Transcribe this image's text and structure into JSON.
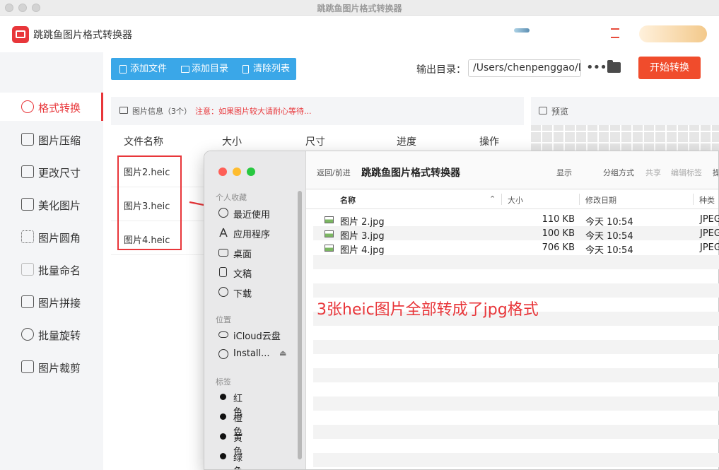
{
  "window": {
    "title": "跳跳鱼图片格式转换器"
  },
  "app": {
    "title": "跳跳鱼图片格式转换器"
  },
  "sidebar": {
    "items": [
      {
        "label": "格式转换",
        "icon": "convert-icon"
      },
      {
        "label": "图片压缩",
        "icon": "compress-icon"
      },
      {
        "label": "更改尺寸",
        "icon": "resize-icon"
      },
      {
        "label": "美化图片",
        "icon": "beautify-icon"
      },
      {
        "label": "图片圆角",
        "icon": "round-corner-icon"
      },
      {
        "label": "批量命名",
        "icon": "rename-icon"
      },
      {
        "label": "图片拼接",
        "icon": "splice-icon"
      },
      {
        "label": "批量旋转",
        "icon": "rotate-icon"
      },
      {
        "label": "图片裁剪",
        "icon": "crop-icon"
      }
    ],
    "active": "格式转换"
  },
  "toolbar": {
    "add_file": "添加文件",
    "add_dir": "添加目录",
    "clear_list": "清除列表",
    "output_label": "输出目录：",
    "output_path": "/Users/chenpenggao/D",
    "more": "•••",
    "start": "开始转换"
  },
  "info": {
    "title": "图片信息（3个）",
    "warning": "注意：如果图片较大请耐心等待..."
  },
  "table": {
    "headers": [
      "文件名称",
      "大小",
      "尺寸",
      "进度",
      "操作"
    ],
    "rows": [
      "图片2.heic",
      "图片3.heic",
      "图片4.heic"
    ]
  },
  "preview": {
    "title": "预览"
  },
  "finder": {
    "sections": {
      "favorites": "个人收藏",
      "locations": "位置",
      "tags": "标签"
    },
    "favorites": [
      {
        "label": "最近使用",
        "icon": "clock-icon"
      },
      {
        "label": "应用程序",
        "icon": "apps-icon"
      },
      {
        "label": "桌面",
        "icon": "desktop-icon"
      },
      {
        "label": "文稿",
        "icon": "document-icon"
      },
      {
        "label": "下载",
        "icon": "download-icon"
      }
    ],
    "locations": [
      {
        "label": "iCloud云盘",
        "icon": "cloud-icon"
      },
      {
        "label": "Install...",
        "icon": "disk-icon"
      }
    ],
    "tags": [
      "红色",
      "橙色",
      "黄色",
      "绿色"
    ],
    "toolbar": {
      "back_forward": "返回/前进",
      "title": "跳跳鱼图片格式转换器",
      "view": "显示",
      "group": "分组方式",
      "share": "共享",
      "edit_tags": "编辑标签",
      "more": "操"
    },
    "columns": {
      "name": "名称",
      "size": "大小",
      "modified": "修改日期",
      "kind": "种类"
    },
    "files": [
      {
        "name": "图片 2.jpg",
        "size": "110 KB",
        "date": "今天 10:54",
        "kind": "JPEG"
      },
      {
        "name": "图片 3.jpg",
        "size": "100 KB",
        "date": "今天 10:54",
        "kind": "JPEG"
      },
      {
        "name": "图片 4.jpg",
        "size": "706 KB",
        "date": "今天 10:54",
        "kind": "JPEG"
      }
    ]
  },
  "annotation": {
    "caption": "3张heic图片全部转成了jpg格式"
  },
  "colors": {
    "accent": "#e8363a",
    "toolbar_blue": "#3aa7e8",
    "start_button": "#f04c2c"
  }
}
